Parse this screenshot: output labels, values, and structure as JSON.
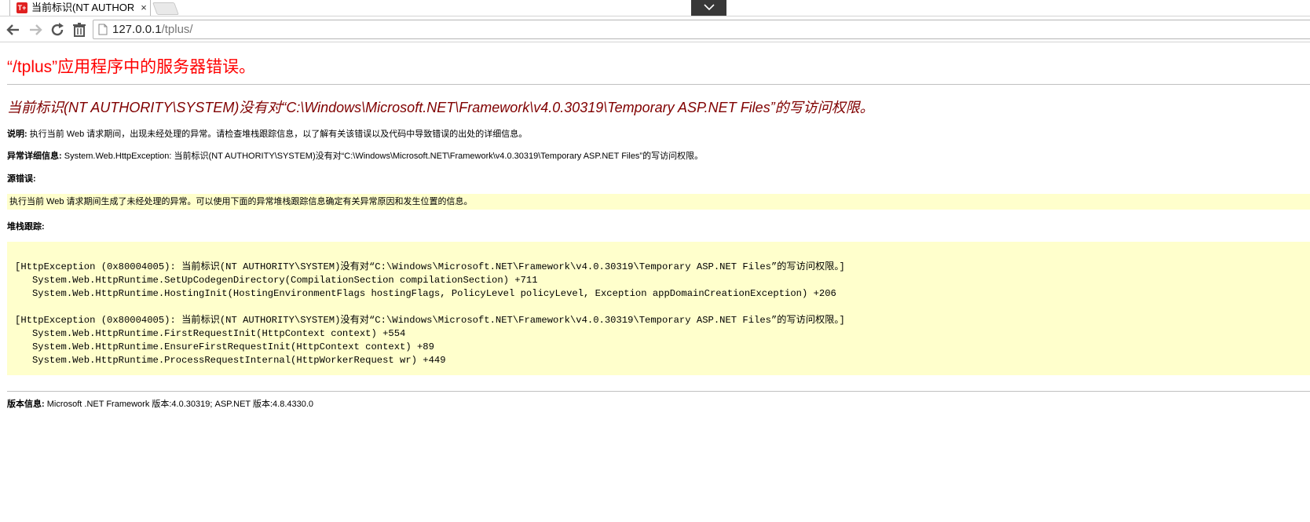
{
  "browser": {
    "tab_title": "当前标识(NT AUTHORITY\\SYSTEM)没有对",
    "favicon_text": "T+",
    "close_glyph": "×",
    "url_host": "127.0.0.1",
    "url_path": "/tplus/"
  },
  "page": {
    "heading": "“/tplus”应用程序中的服务器错误。",
    "sub_heading": "当前标识(NT AUTHORITY\\SYSTEM)没有对“C:\\Windows\\Microsoft.NET\\Framework\\v4.0.30319\\Temporary ASP.NET Files”的写访问权限。",
    "description_label": "说明:",
    "description_text": " 执行当前 Web 请求期间，出现未经处理的异常。请检查堆栈跟踪信息，以了解有关该错误以及代码中导致错误的出处的详细信息。",
    "exception_label": "异常详细信息:",
    "exception_text": " System.Web.HttpException: 当前标识(NT AUTHORITY\\SYSTEM)没有对“C:\\Windows\\Microsoft.NET\\Framework\\v4.0.30319\\Temporary ASP.NET Files”的写访问权限。",
    "source_label": "源错误:",
    "source_text": "执行当前 Web 请求期间生成了未经处理的异常。可以使用下面的异常堆栈跟踪信息确定有关异常原因和发生位置的信息。",
    "stack_label": "堆栈跟踪:",
    "stack_block1": [
      "[HttpException (0x80004005): 当前标识(NT AUTHORITY\\SYSTEM)没有对“C:\\Windows\\Microsoft.NET\\Framework\\v4.0.30319\\Temporary ASP.NET Files”的写访问权限。]",
      "   System.Web.HttpRuntime.SetUpCodegenDirectory(CompilationSection compilationSection) +711",
      "   System.Web.HttpRuntime.HostingInit(HostingEnvironmentFlags hostingFlags, PolicyLevel policyLevel, Exception appDomainCreationException) +206"
    ],
    "stack_block2": [
      "[HttpException (0x80004005): 当前标识(NT AUTHORITY\\SYSTEM)没有对“C:\\Windows\\Microsoft.NET\\Framework\\v4.0.30319\\Temporary ASP.NET Files”的写访问权限。]",
      "   System.Web.HttpRuntime.FirstRequestInit(HttpContext context) +554",
      "   System.Web.HttpRuntime.EnsureFirstRequestInit(HttpContext context) +89",
      "   System.Web.HttpRuntime.ProcessRequestInternal(HttpWorkerRequest wr) +449"
    ],
    "version_label": "版本信息:",
    "version_text": " Microsoft .NET Framework 版本:4.0.30319; ASP.NET 版本:4.8.4330.0"
  },
  "colors": {
    "heading": "#ff0000",
    "sub_heading": "#800000",
    "code_background": "#ffffcc",
    "favicon": "#e02020"
  },
  "icons": [
    "back-arrow-icon",
    "forward-arrow-icon",
    "reload-icon",
    "trash-icon",
    "page-icon",
    "chevron-down-icon"
  ]
}
